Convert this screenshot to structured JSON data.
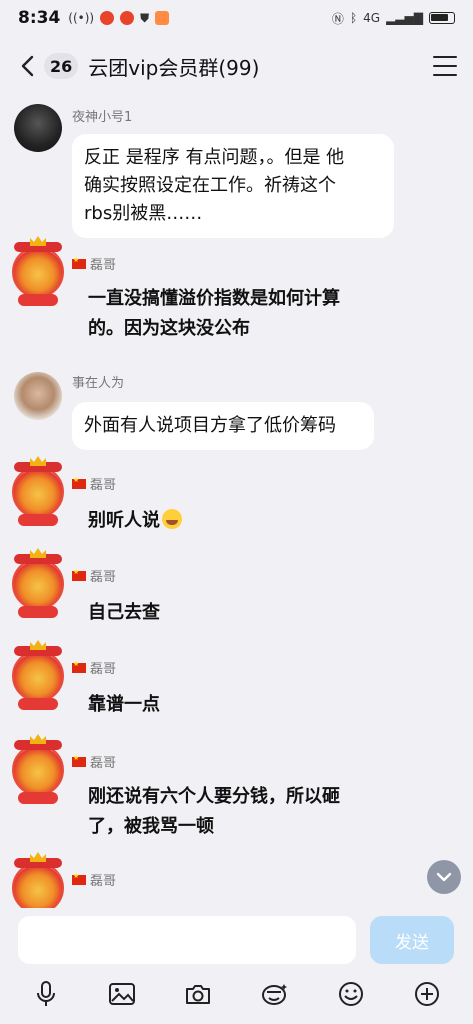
{
  "status_bar": {
    "time": "8:34",
    "network": "4G"
  },
  "header": {
    "unread_count": "26",
    "title": "云团vip会员群(99)"
  },
  "messages": [
    {
      "sender": "夜神小号1",
      "type": "bubble",
      "lines": [
        "反正 是程序 有点问题，。但是 他",
        "确实按照设定在工作。祈祷这个",
        "rbs别被黑……"
      ]
    },
    {
      "sender": "磊哥",
      "type": "plain",
      "lines": [
        "一直没搞懂溢价指数是如何计算",
        "的。因为这块没公布"
      ]
    },
    {
      "sender": "事在人为",
      "type": "bubble",
      "lines": [
        "外面有人说项目方拿了低价筹码"
      ]
    },
    {
      "sender": "磊哥",
      "type": "plain",
      "lines": [
        "别听人说"
      ]
    },
    {
      "sender": "磊哥",
      "type": "plain",
      "lines": [
        "自己去查"
      ]
    },
    {
      "sender": "磊哥",
      "type": "plain",
      "lines": [
        "靠谱一点"
      ]
    },
    {
      "sender": "磊哥",
      "type": "plain",
      "lines": [
        "刚还说有六个人要分钱，所以砸",
        "了，被我骂一顿"
      ]
    },
    {
      "sender": "磊哥",
      "type": "plain",
      "lines": []
    }
  ],
  "input": {
    "value": "",
    "send_label": "发送"
  },
  "toolbar": {
    "items": [
      "microphone-icon",
      "image-icon",
      "camera-icon",
      "sticker-icon",
      "emoji-icon",
      "plus-icon"
    ]
  },
  "colors": {
    "background": "#f1f1f5",
    "bubble": "#ffffff",
    "send_disabled": "#b9dcf9",
    "badge": "#e2e2e8"
  }
}
